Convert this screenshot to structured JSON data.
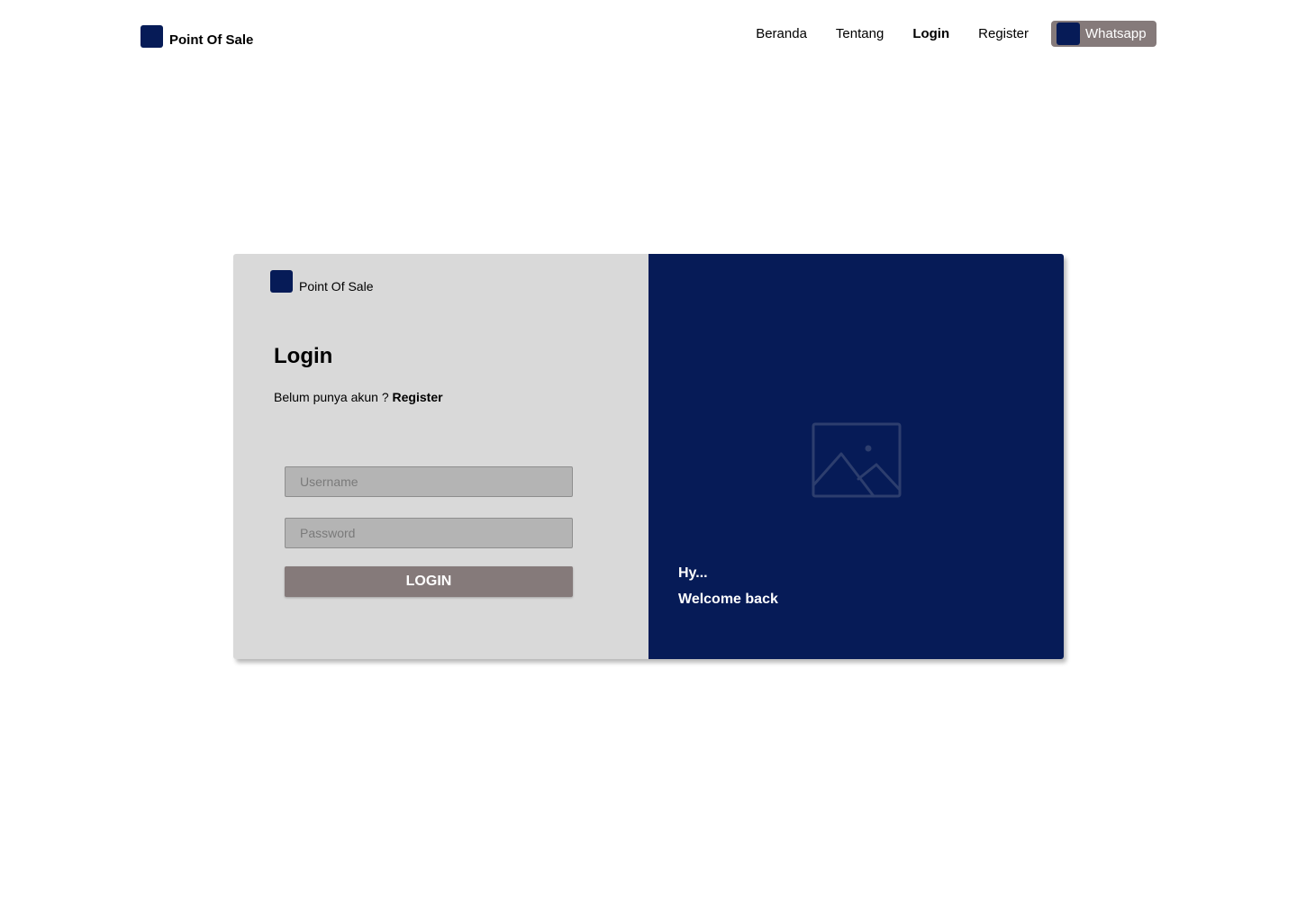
{
  "colors": {
    "brand": "#061b57",
    "card_left_bg": "#d9d9d9",
    "card_right_bg": "#061b57",
    "button_bg": "#857a7a",
    "placeholder_icon": "#2d3e6e"
  },
  "navbar": {
    "brand": {
      "name": "Point Of Sale",
      "logo_icon": "square-logo-icon"
    },
    "links": [
      {
        "label": "Beranda",
        "active": false
      },
      {
        "label": "Tentang",
        "active": false
      },
      {
        "label": "Login",
        "active": true
      },
      {
        "label": "Register",
        "active": false
      }
    ],
    "whatsapp": {
      "label": "Whatsapp",
      "icon": "whatsapp-icon"
    }
  },
  "login_card": {
    "brand": {
      "name": "Point Of Sale",
      "logo_icon": "square-logo-icon"
    },
    "title": "Login",
    "signup_prompt": "Belum punya akun ?",
    "signup_link": "Register",
    "username": {
      "placeholder": "Username",
      "value": ""
    },
    "password": {
      "placeholder": "Password",
      "value": ""
    },
    "submit_label": "LOGIN",
    "side": {
      "image_icon": "image-placeholder-icon",
      "greeting": "Hy...",
      "welcome": "Welcome back"
    }
  }
}
